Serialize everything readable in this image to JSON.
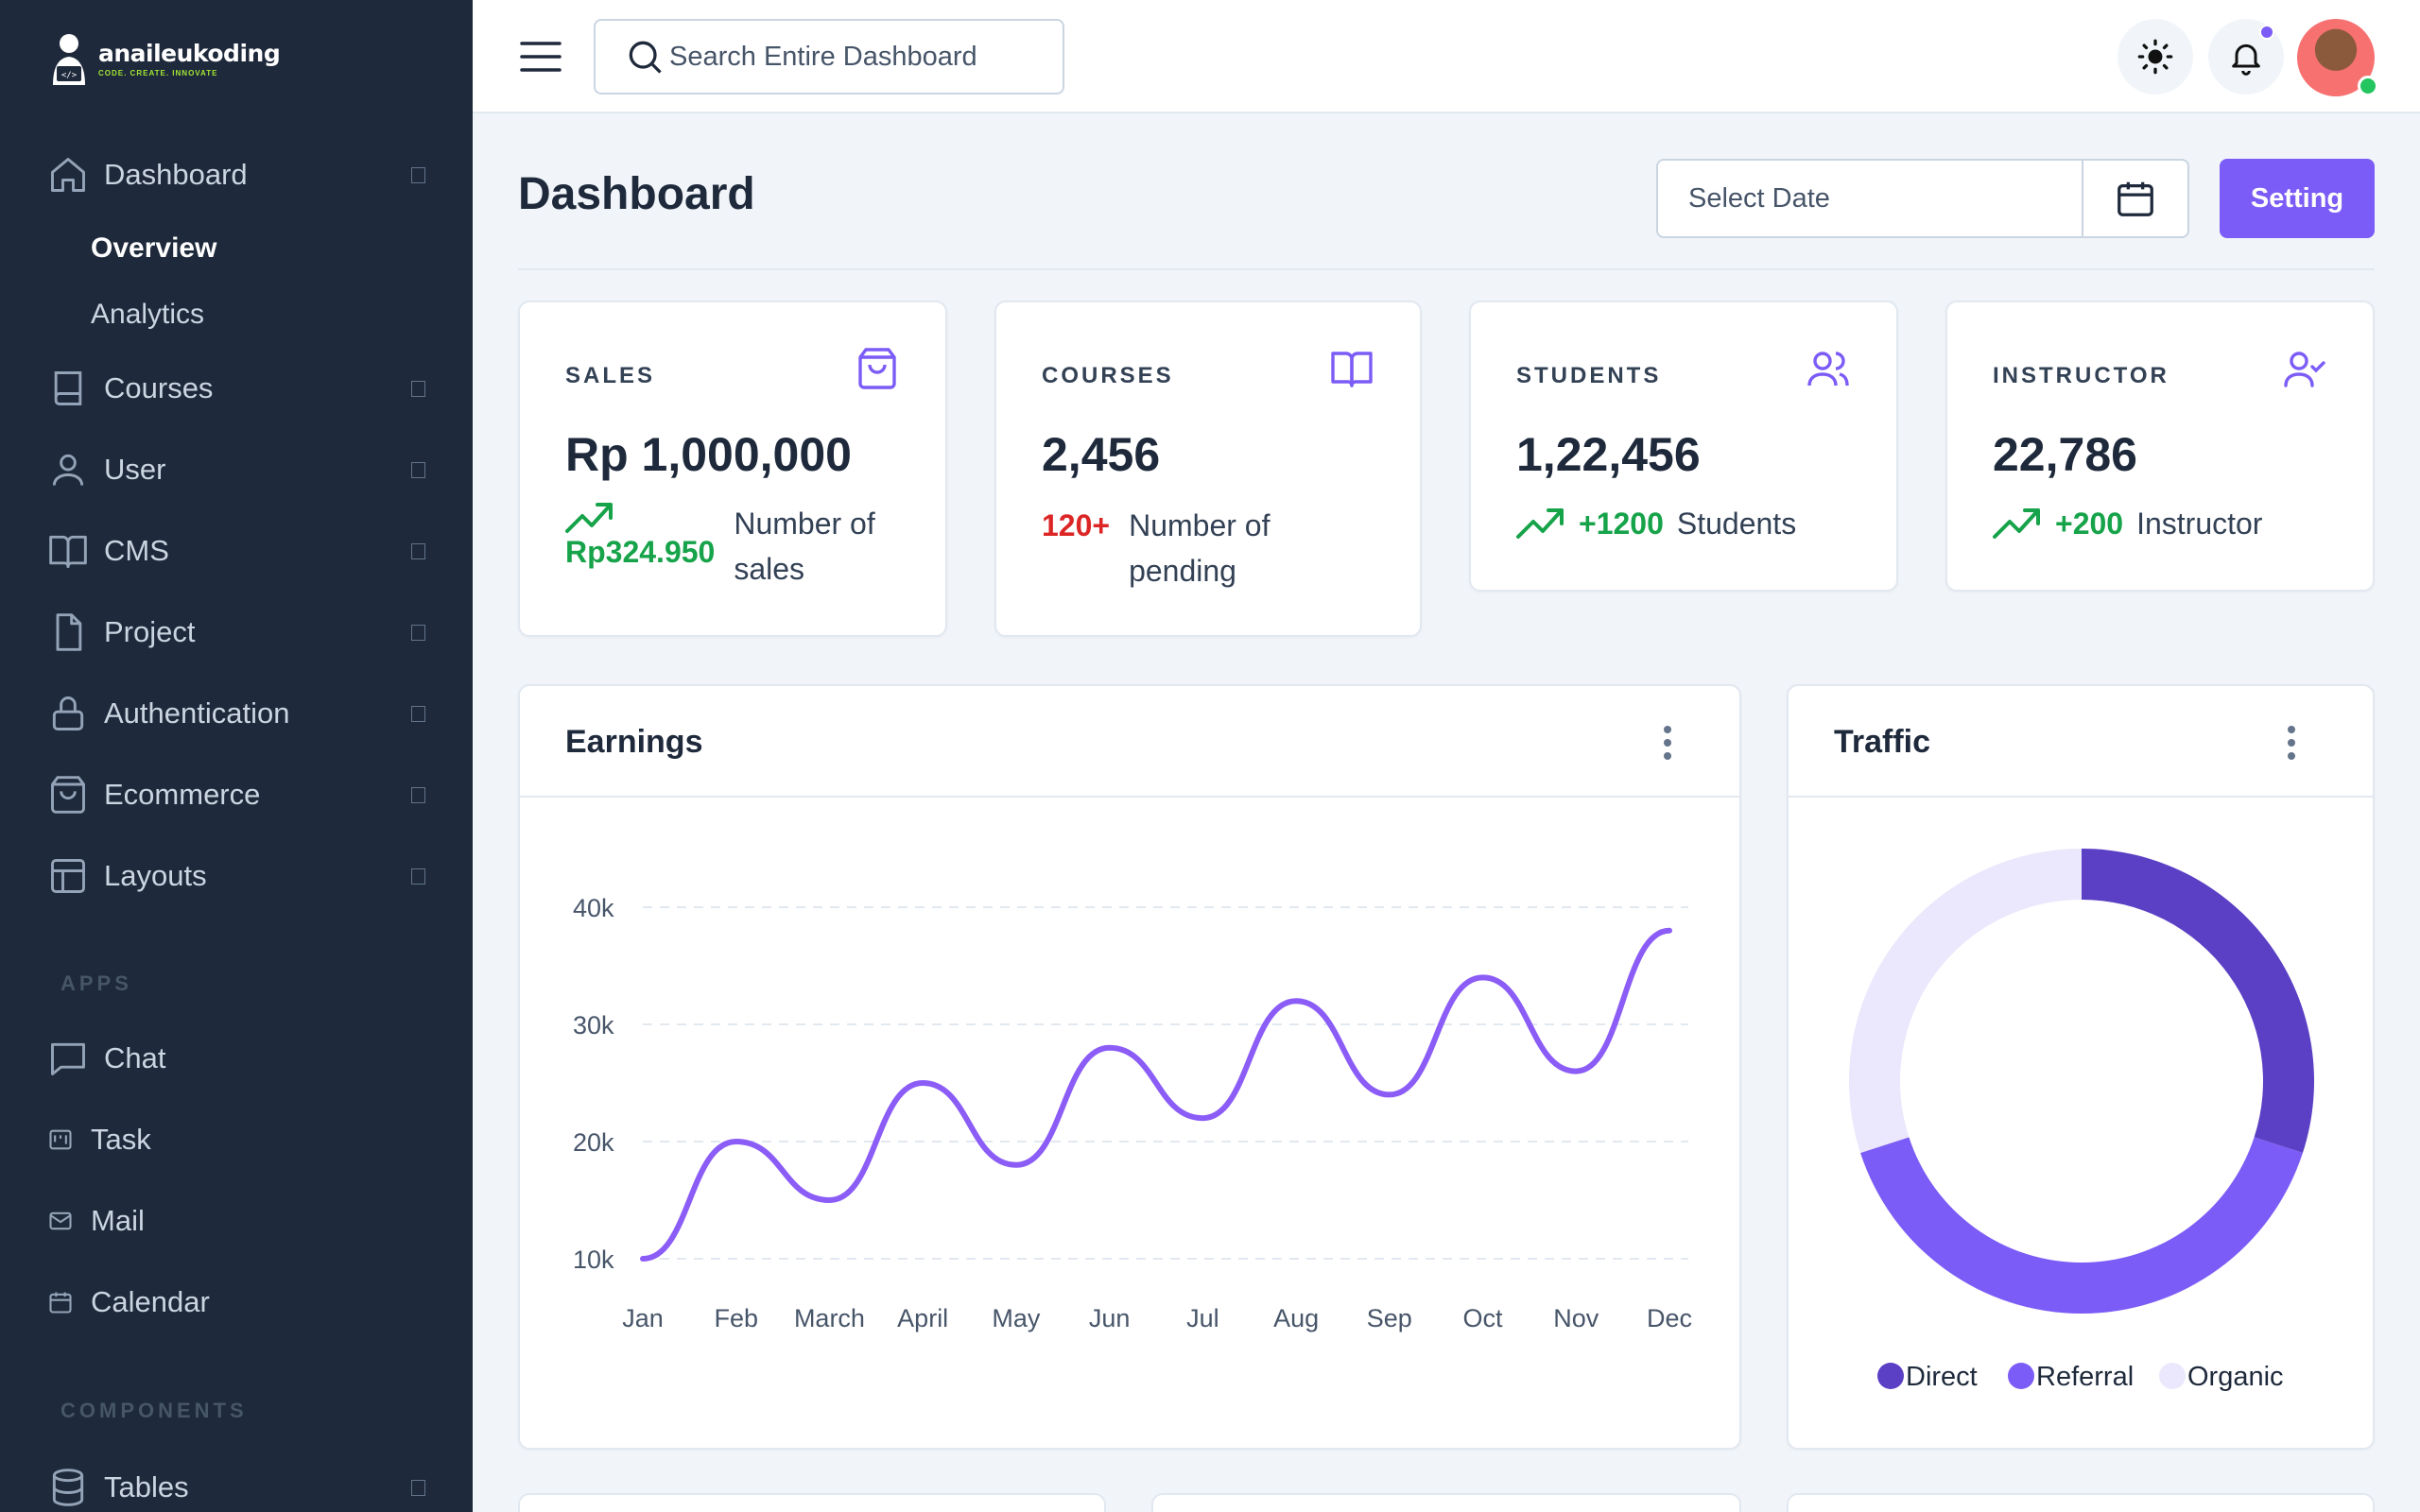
{
  "brand": {
    "name": "anaileukoding",
    "tagline": "CODE. CREATE. INNOVATE"
  },
  "sidebar": {
    "items": [
      {
        "label": "Dashboard",
        "icon": "home-icon"
      },
      {
        "label": "Courses",
        "icon": "book-icon"
      },
      {
        "label": "User",
        "icon": "user-icon"
      },
      {
        "label": "CMS",
        "icon": "open-book-icon"
      },
      {
        "label": "Project",
        "icon": "file-icon"
      },
      {
        "label": "Authentication",
        "icon": "lock-icon"
      },
      {
        "label": "Ecommerce",
        "icon": "shopping-bag-icon"
      },
      {
        "label": "Layouts",
        "icon": "layout-icon"
      }
    ],
    "subitems": [
      {
        "label": "Overview",
        "active": true
      },
      {
        "label": "Analytics",
        "active": false
      }
    ],
    "apps_label": "APPS",
    "apps": [
      {
        "label": "Chat",
        "icon": "chat-icon"
      },
      {
        "label": "Task",
        "icon": "kanban-icon"
      },
      {
        "label": "Mail",
        "icon": "mail-icon"
      },
      {
        "label": "Calendar",
        "icon": "calendar-icon"
      }
    ],
    "components_label": "COMPONENTS",
    "components": [
      {
        "label": "Tables",
        "icon": "database-icon"
      }
    ]
  },
  "topbar": {
    "search_placeholder": "Search Entire Dashboard",
    "theme_icon": "sun-icon",
    "notification_icon": "bell-icon"
  },
  "page": {
    "title": "Dashboard",
    "date_placeholder": "Select Date",
    "setting_label": "Setting"
  },
  "stats": [
    {
      "label": "SALES",
      "icon": "shopping-bag-icon",
      "value": "Rp 1,000,000",
      "delta": "Rp324.950",
      "delta_color": "green",
      "desc": "Number of sales"
    },
    {
      "label": "COURSES",
      "icon": "open-book-icon",
      "value": "2,456",
      "delta": "120+",
      "delta_color": "red",
      "desc": "Number of pending"
    },
    {
      "label": "STUDENTS",
      "icon": "users-icon",
      "value": "1,22,456",
      "delta": "+1200",
      "delta_color": "green",
      "desc": "Students"
    },
    {
      "label": "INSTRUCTOR",
      "icon": "user-check-icon",
      "value": "22,786",
      "delta": "+200",
      "delta_color": "green",
      "desc": "Instructor"
    }
  ],
  "earnings": {
    "title": "Earnings"
  },
  "traffic": {
    "title": "Traffic"
  },
  "colors": {
    "accent": "#7c5cf6",
    "sidebar_bg": "#1e293b",
    "green": "#16a34a",
    "red": "#dc2626"
  },
  "chart_data": [
    {
      "type": "line",
      "title": "Earnings",
      "categories": [
        "Jan",
        "Feb",
        "March",
        "April",
        "May",
        "Jun",
        "Jul",
        "Aug",
        "Sep",
        "Oct",
        "Nov",
        "Dec"
      ],
      "values": [
        10000,
        20000,
        15000,
        25000,
        18000,
        28000,
        22000,
        32000,
        24000,
        34000,
        26000,
        38000
      ],
      "yticks": [
        "10k",
        "20k",
        "30k",
        "40k"
      ],
      "ylim": [
        10000,
        40000
      ],
      "grid": true,
      "smooth": true,
      "color": "#8b5cf6"
    },
    {
      "type": "pie",
      "title": "Traffic",
      "donut": true,
      "labels": [
        "Direct",
        "Referral",
        "Organic"
      ],
      "values": [
        30,
        40,
        30
      ],
      "colors": [
        "#5b3fc4",
        "#7c5cf6",
        "#ebe7fc"
      ],
      "legend": "bottom"
    }
  ]
}
